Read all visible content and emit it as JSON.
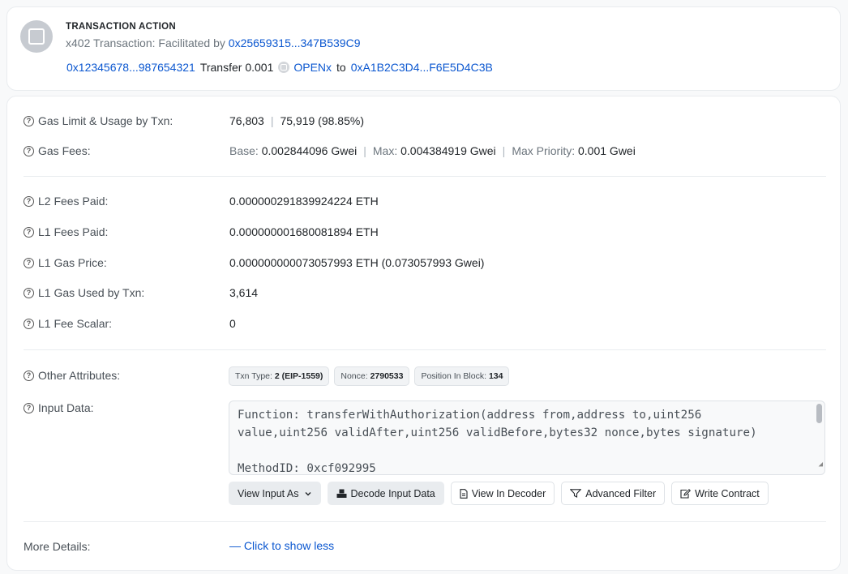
{
  "action": {
    "title": "TRANSACTION ACTION",
    "line1_prefix": "x402 Transaction: Facilitated by",
    "facilitator": "0x25659315...347B539C9",
    "from": "0x12345678...987654321",
    "transfer_text": "Transfer 0.001",
    "token": "OPENx",
    "to_text": "to",
    "to": "0xA1B2C3D4...F6E5D4C3B"
  },
  "details": {
    "gas_limit": {
      "label": "Gas Limit & Usage by Txn:",
      "limit": "76,803",
      "usage": "75,919 (98.85%)"
    },
    "gas_fees": {
      "label": "Gas Fees:",
      "base_label": "Base:",
      "base": "0.002844096 Gwei",
      "max_label": "Max:",
      "max": "0.004384919 Gwei",
      "priority_label": "Max Priority:",
      "priority": "0.001 Gwei"
    },
    "l2_fees": {
      "label": "L2 Fees Paid:",
      "value": "0.000000291839924224 ETH"
    },
    "l1_fees": {
      "label": "L1 Fees Paid:",
      "value": "0.000000001680081894 ETH"
    },
    "l1_gas_price": {
      "label": "L1 Gas Price:",
      "value": "0.000000000073057993 ETH (0.073057993 Gwei)"
    },
    "l1_gas_used": {
      "label": "L1 Gas Used by Txn:",
      "value": "3,614"
    },
    "l1_fee_scalar": {
      "label": "L1 Fee Scalar:",
      "value": "0"
    },
    "other_attributes": {
      "label": "Other Attributes:",
      "txn_type_label": "Txn Type:",
      "txn_type": "2 (EIP-1559)",
      "nonce_label": "Nonce:",
      "nonce": "2790533",
      "position_label": "Position In Block:",
      "position": "134"
    },
    "input_data": {
      "label": "Input Data:",
      "code": "Function: transferWithAuthorization(address from,address to,uint256\nvalue,uint256 validAfter,uint256 validBefore,bytes32 nonce,bytes signature)\n\nMethodID: 0xcf092995",
      "buttons": {
        "view_input_as": "View Input As",
        "decode": "Decode Input Data",
        "view_decoder": "View In Decoder",
        "advanced_filter": "Advanced Filter",
        "write_contract": "Write Contract"
      }
    },
    "more_details": {
      "label": "More Details:",
      "link": "— Click to show less"
    }
  },
  "colors": {
    "link": "#0b57d0",
    "muted": "#6c757d",
    "border": "#e9ecef"
  },
  "icons": [
    "question-circle-icon",
    "token-icon",
    "chevron-down-icon",
    "cubes-icon",
    "file-icon",
    "filter-icon",
    "edit-icon"
  ]
}
